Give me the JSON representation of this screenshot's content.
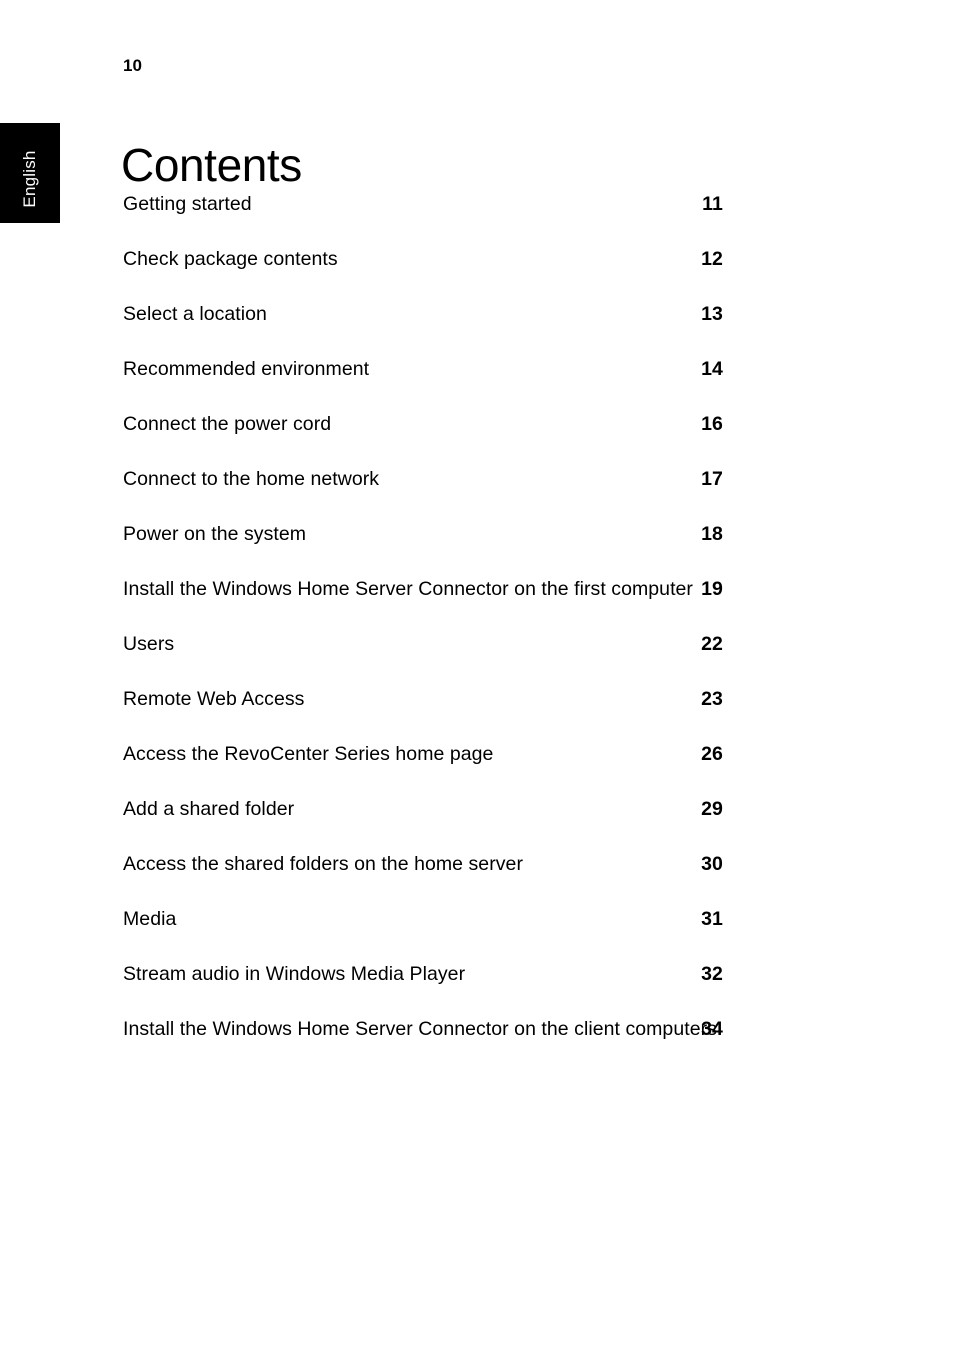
{
  "page": {
    "folio": "10",
    "title": "Contents",
    "background_color": "#ffffff",
    "text_color": "#000000"
  },
  "language_tab": {
    "label": "English",
    "background_color": "#000000",
    "text_color": "#ffffff"
  },
  "toc": {
    "entries": [
      {
        "label": "Getting started",
        "page": "11",
        "wrapped": false
      },
      {
        "label": "Check package contents",
        "page": "12",
        "wrapped": false
      },
      {
        "label": "Select a location",
        "page": "13",
        "wrapped": false
      },
      {
        "label": "Recommended environment",
        "page": "14",
        "wrapped": false
      },
      {
        "label": "Connect the power cord",
        "page": "16",
        "wrapped": false
      },
      {
        "label": "Connect to the home network",
        "page": "17",
        "wrapped": false
      },
      {
        "label": "Power on the system",
        "page": "18",
        "wrapped": false
      },
      {
        "label": "Install the Windows Home Server Connector on the first computer",
        "page": "19",
        "wrapped": true
      },
      {
        "label": "Users",
        "page": "22",
        "wrapped": false
      },
      {
        "label": "Remote Web Access",
        "page": "23",
        "wrapped": false
      },
      {
        "label": "Access the RevoCenter Series home page",
        "page": "26",
        "wrapped": false
      },
      {
        "label": "Add a shared folder",
        "page": "29",
        "wrapped": false
      },
      {
        "label": "Access the shared folders on the home server",
        "page": "30",
        "wrapped": false
      },
      {
        "label": "Media",
        "page": "31",
        "wrapped": false
      },
      {
        "label": "Stream audio in Windows Media Player",
        "page": "32",
        "wrapped": false
      },
      {
        "label": "Install the Windows Home Server Connector on the client computers",
        "page": "34",
        "wrapped": true
      }
    ]
  }
}
